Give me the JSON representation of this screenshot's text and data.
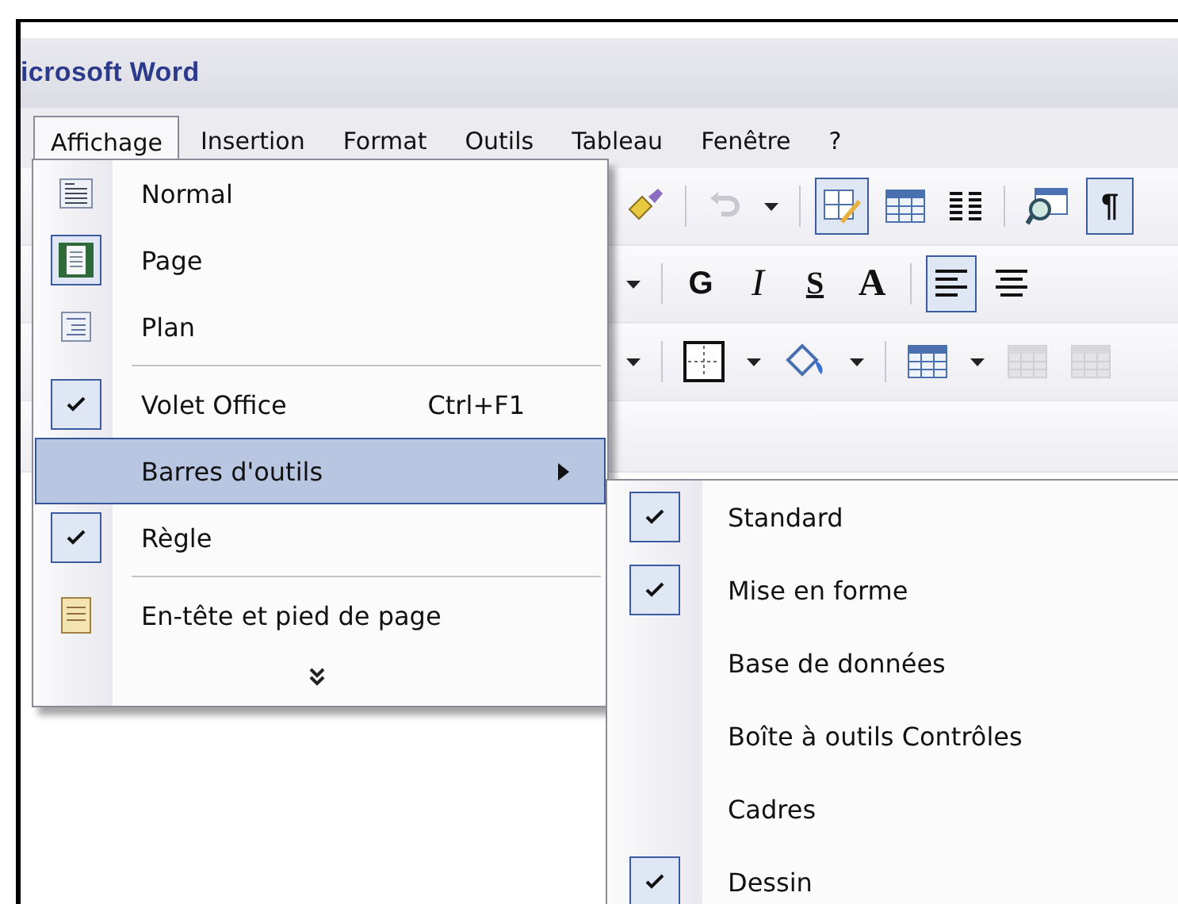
{
  "window": {
    "title": "icrosoft Word"
  },
  "menubar": [
    {
      "label": "Affichage",
      "selected": true
    },
    {
      "label": "Insertion",
      "selected": false
    },
    {
      "label": "Format",
      "selected": false
    },
    {
      "label": "Outils",
      "selected": false
    },
    {
      "label": "Tableau",
      "selected": false
    },
    {
      "label": "Fenêtre",
      "selected": false
    },
    {
      "label": "?",
      "selected": false
    }
  ],
  "toolbars": [
    [
      {
        "kind": "brush",
        "pressed": false
      },
      {
        "kind": "sep"
      },
      {
        "kind": "undo",
        "pressed": false
      },
      {
        "kind": "caret",
        "pressed": false
      },
      {
        "kind": "sep"
      },
      {
        "kind": "drawtable",
        "pressed": true
      },
      {
        "kind": "table",
        "pressed": false
      },
      {
        "kind": "columns",
        "pressed": false
      },
      {
        "kind": "sep"
      },
      {
        "kind": "preview",
        "pressed": false
      },
      {
        "kind": "bold",
        "text": "¶",
        "pressed": true
      }
    ],
    [
      {
        "kind": "caret",
        "pressed": false
      },
      {
        "kind": "sep"
      },
      {
        "kind": "bold",
        "text": "G",
        "pressed": false
      },
      {
        "kind": "italic",
        "text": "I",
        "pressed": false
      },
      {
        "kind": "underline",
        "text": "S",
        "pressed": false
      },
      {
        "kind": "serif",
        "text": "A",
        "pressed": false
      },
      {
        "kind": "sep"
      },
      {
        "kind": "alignleft",
        "pressed": true
      },
      {
        "kind": "aligncenter",
        "pressed": false
      }
    ],
    [
      {
        "kind": "caret",
        "pressed": false
      },
      {
        "kind": "sep"
      },
      {
        "kind": "border",
        "pressed": false
      },
      {
        "kind": "caret",
        "pressed": false
      },
      {
        "kind": "bucket",
        "pressed": false
      },
      {
        "kind": "caret",
        "pressed": false
      },
      {
        "kind": "sep"
      },
      {
        "kind": "table",
        "pressed": false
      },
      {
        "kind": "caret",
        "pressed": false
      },
      {
        "kind": "greytable",
        "pressed": false
      },
      {
        "kind": "greytable",
        "pressed": false
      }
    ]
  ],
  "view_menu": [
    {
      "kind": "normal",
      "label": "Normal",
      "checked": false,
      "selected": false
    },
    {
      "kind": "page",
      "label": "Page",
      "checked": true,
      "selected": false
    },
    {
      "kind": "outline",
      "label": "Plan",
      "checked": false,
      "selected": false
    },
    {
      "kind": "separator"
    },
    {
      "kind": "check",
      "label": "Volet Office",
      "checked": true,
      "shortcut": "Ctrl+F1",
      "selected": false
    },
    {
      "kind": "submenu",
      "label": "Barres d'outils",
      "selected": true
    },
    {
      "kind": "check",
      "label": "Règle",
      "checked": true,
      "selected": false
    },
    {
      "kind": "separator"
    },
    {
      "kind": "header",
      "label": "En-tête et pied de page",
      "checked": false,
      "selected": false
    }
  ],
  "toolbars_submenu": [
    {
      "label": "Standard",
      "checked": true
    },
    {
      "label": "Mise en forme",
      "checked": true
    },
    {
      "label": "Base de données",
      "checked": false
    },
    {
      "label": "Boîte à outils Contrôles",
      "checked": false
    },
    {
      "label": "Cadres",
      "checked": false
    },
    {
      "label": "Dessin",
      "checked": true
    }
  ]
}
